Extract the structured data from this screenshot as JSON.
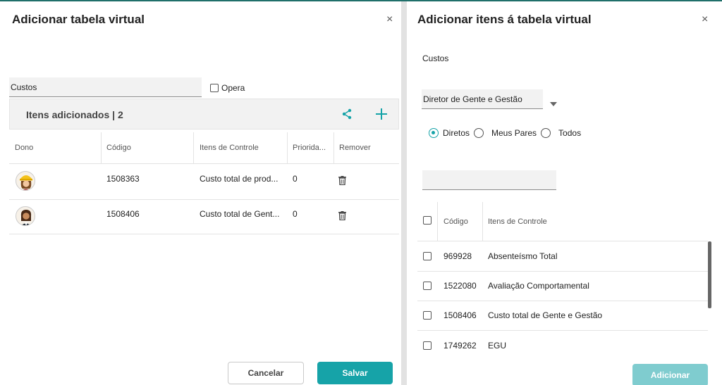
{
  "left_panel": {
    "title": "Adicionar tabela virtual",
    "close": "×",
    "name_value": "Custos",
    "opera_label": "Opera",
    "itens_label": "Itens adicionados | 2",
    "columns": [
      "Dono",
      "Código",
      "Itens de Controle",
      "Priorida...",
      "Remover"
    ],
    "rows": [
      {
        "codigo": "1508363",
        "item": "Custo total de prod...",
        "prioridade": "0"
      },
      {
        "codigo": "1508406",
        "item": "Custo total de Gent...",
        "prioridade": "0"
      }
    ],
    "cancel_label": "Cancelar",
    "save_label": "Salvar"
  },
  "right_panel": {
    "title": "Adicionar itens á tabela virtual",
    "close": "×",
    "subtitle": "Custos",
    "select_value": "Diretor de Gente e Gestão",
    "radios": [
      "Diretos",
      "Meus Pares",
      "Todos"
    ],
    "radio_selected": "Diretos",
    "search_value": "",
    "columns": [
      "Código",
      "Itens de Controle"
    ],
    "rows": [
      {
        "codigo": "969928",
        "item": "Absenteísmo Total"
      },
      {
        "codigo": "1522080",
        "item": "Avaliação Comportamental"
      },
      {
        "codigo": "1508406",
        "item": "Custo total de Gente e Gestão"
      },
      {
        "codigo": "1749262",
        "item": "EGU"
      }
    ],
    "add_label": "Adicionar"
  },
  "colors": {
    "accent": "#16a3a8",
    "accent_disabled": "#7fcccf",
    "topline": "#1f6f6a"
  },
  "icons": [
    "close-icon",
    "share-icon",
    "plus-icon",
    "trash-icon",
    "chevron-down-icon"
  ]
}
